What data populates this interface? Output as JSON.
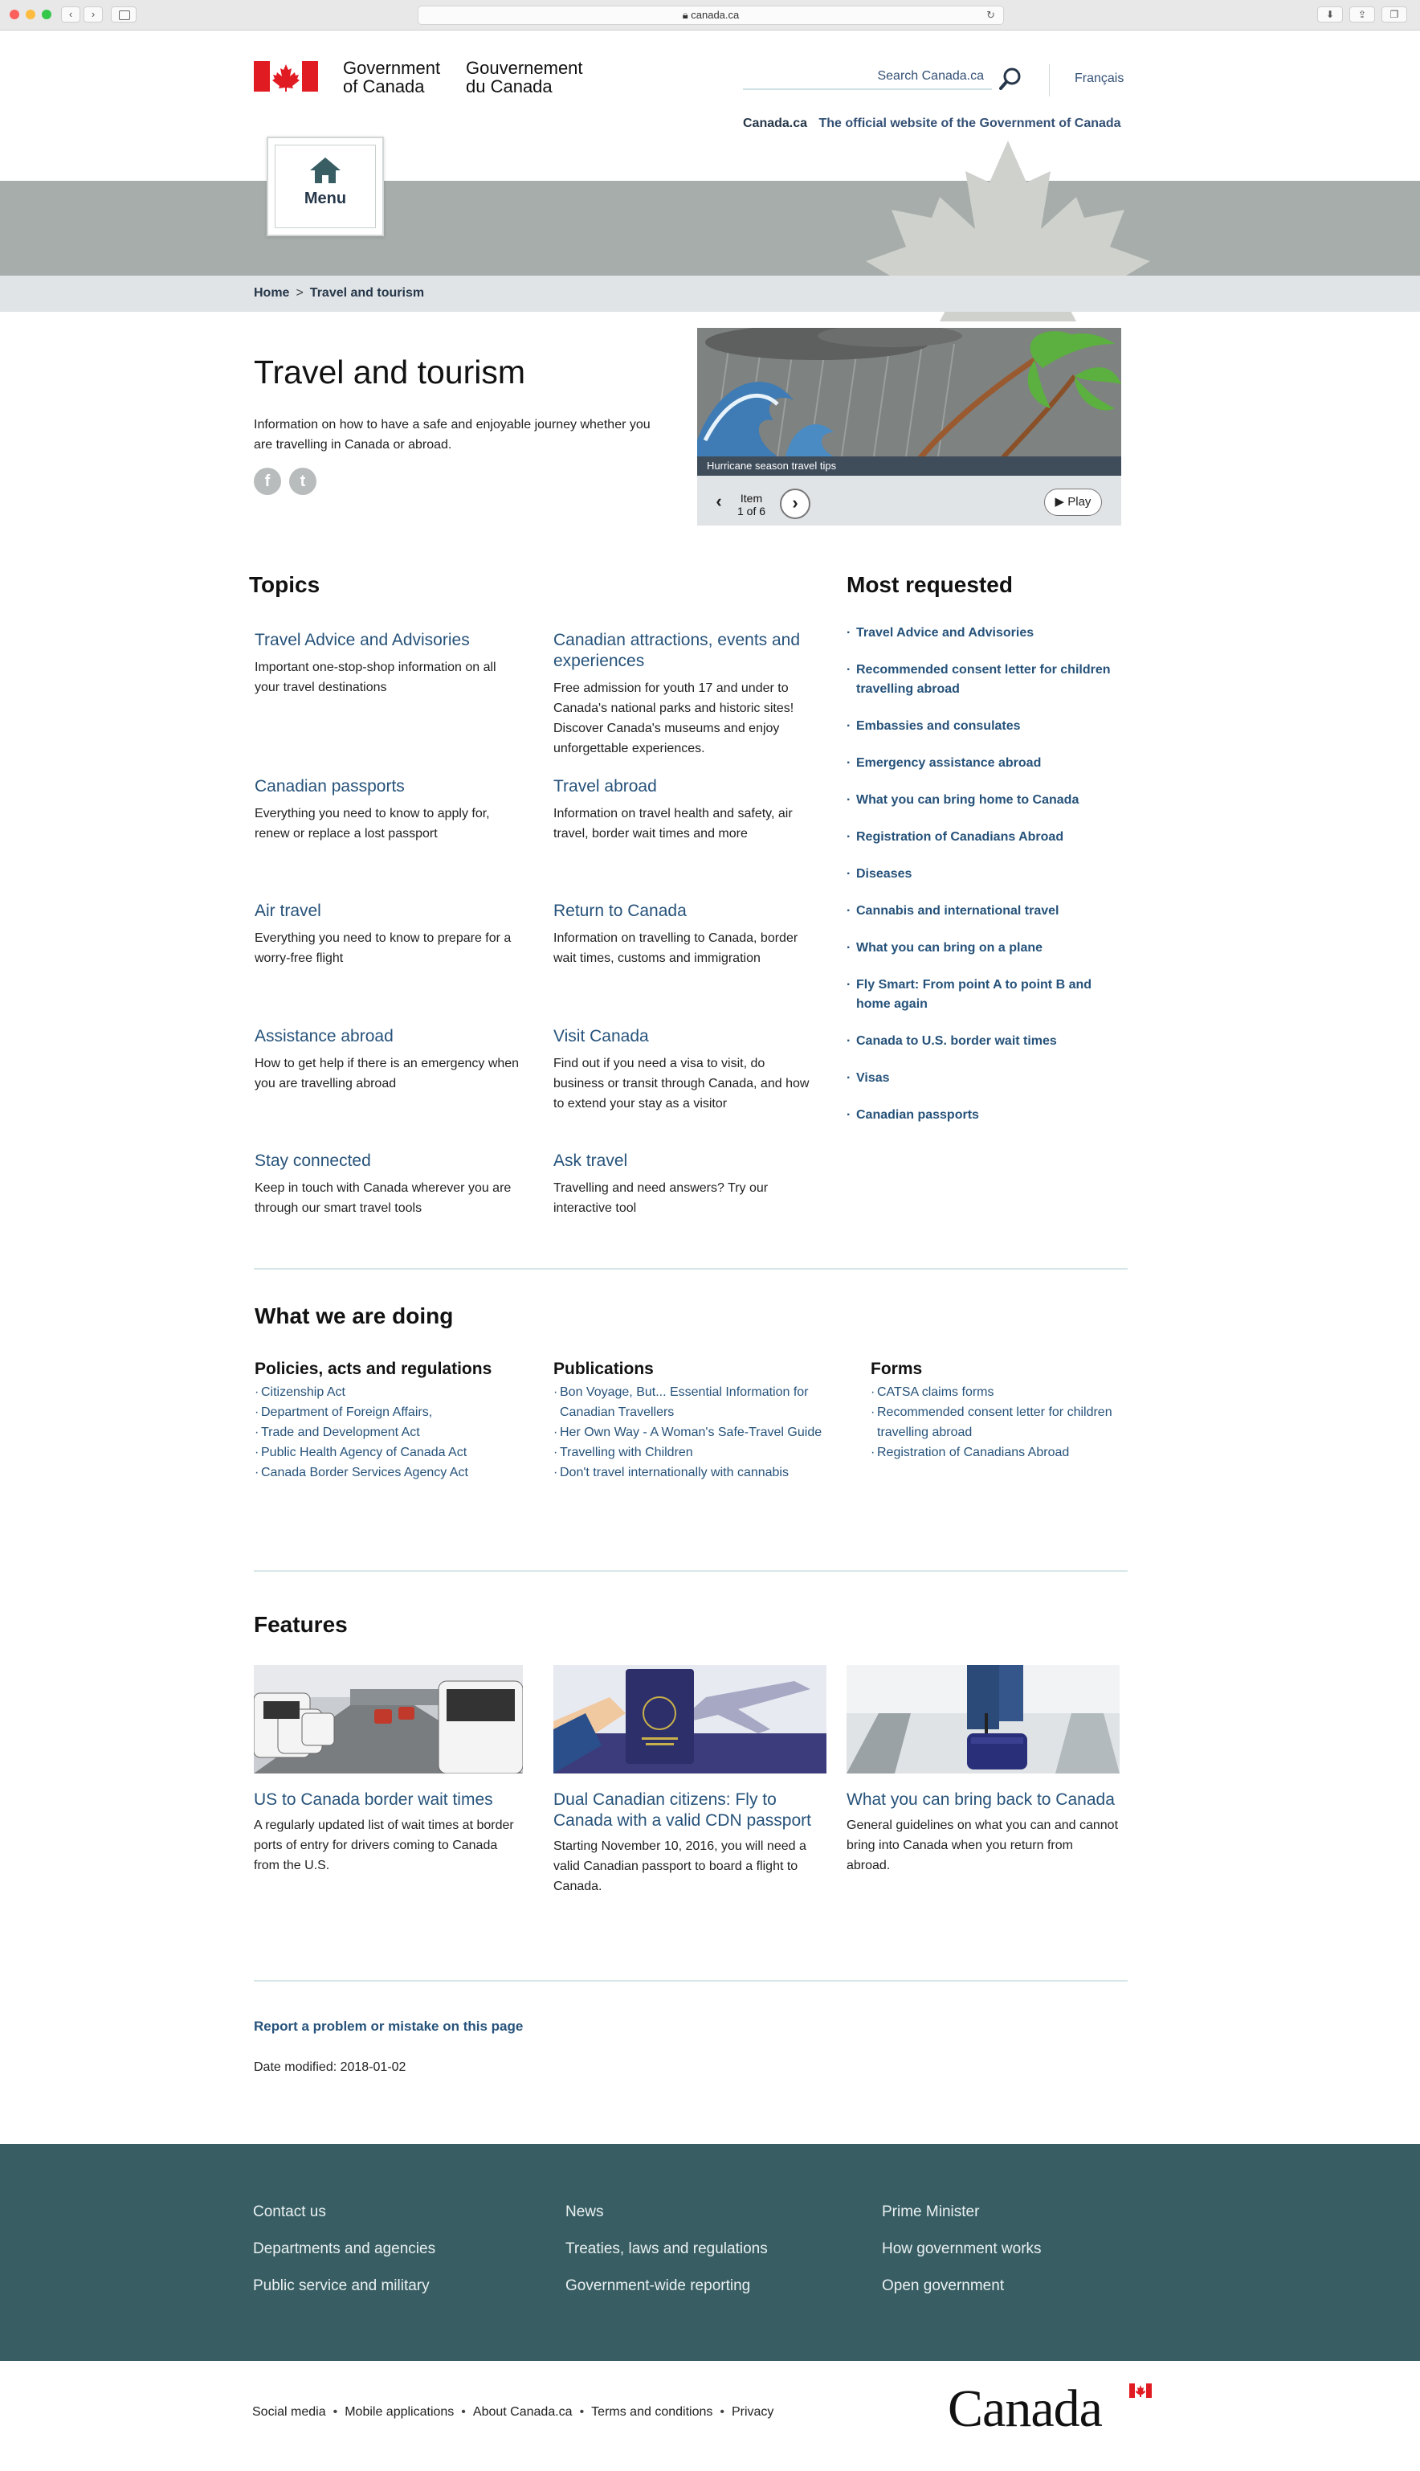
{
  "browser": {
    "url": "canada.ca",
    "colors": {
      "close": "#fc605c",
      "min": "#fdbc40",
      "max": "#34c84a"
    }
  },
  "header": {
    "gov_en_line1": "Government",
    "gov_en_line2": "of Canada",
    "gov_fr_line1": "Gouvernement",
    "gov_fr_line2": "du Canada",
    "search_placeholder": "Search Canada.ca",
    "language": "Français",
    "tagline_brand": "Canada.ca",
    "tagline_rest": "The official website of the Government of Canada",
    "menu_label": "Menu"
  },
  "breadcrumb": {
    "home": "Home",
    "separator": ">",
    "current": "Travel and tourism"
  },
  "page": {
    "title": "Travel and tourism",
    "lead": "Information on how to have a safe and enjoyable journey whether you are travelling in Canada or abroad."
  },
  "carousel": {
    "caption": "Hurricane season travel tips",
    "item_label": "Item",
    "item_count": "1 of 6",
    "play_label": "Play"
  },
  "topics": {
    "heading": "Topics",
    "items": [
      {
        "title": "Travel Advice and Advisories",
        "desc": "Important one-stop-shop information on all your travel destinations"
      },
      {
        "title": "Canadian attractions, events and experiences",
        "desc": "Free admission for youth 17 and under to Canada's national parks and historic sites! Discover Canada's museums and enjoy unforgettable experiences."
      },
      {
        "title": "Canadian passports",
        "desc": "Everything you need to know to apply for, renew or replace a lost passport"
      },
      {
        "title": "Travel abroad",
        "desc": "Information on travel health and safety, air travel, border wait times and more"
      },
      {
        "title": "Air travel",
        "desc": "Everything you need to know to prepare for a worry-free flight"
      },
      {
        "title": "Return to Canada",
        "desc": "Information on travelling to Canada, border wait times, customs and immigration"
      },
      {
        "title": "Assistance abroad",
        "desc": "How to get help if there is an emergency when you are travelling abroad"
      },
      {
        "title": "Visit Canada",
        "desc": "Find out if you need a visa to visit, do business or transit through Canada, and how to extend your stay as a visitor"
      },
      {
        "title": "Stay connected",
        "desc": "Keep in touch with Canada wherever you are through our smart travel tools"
      },
      {
        "title": "Ask travel",
        "desc": "Travelling and need answers? Try our interactive tool"
      }
    ]
  },
  "most_requested": {
    "heading": "Most requested",
    "items": [
      "Travel Advice and Advisories",
      "Recommended consent letter for children travelling abroad",
      "Embassies and consulates",
      "Emergency assistance abroad",
      "What you can bring home to Canada",
      "Registration of Canadians Abroad",
      "Diseases",
      "Cannabis and international travel",
      "What you can bring on a plane",
      "Fly Smart: From point A to point B and home again",
      "Canada to U.S. border wait times",
      "Visas",
      "Canadian passports"
    ]
  },
  "doing": {
    "heading": "What we are doing",
    "policies": {
      "title": "Policies, acts and regulations",
      "items": [
        "Citizenship Act",
        "Department of Foreign Affairs,",
        "Trade and Development Act",
        "Public Health Agency of Canada Act",
        "Canada Border Services Agency Act"
      ]
    },
    "publications": {
      "title": "Publications",
      "items": [
        "Bon Voyage, But... Essential Information for Canadian Travellers",
        "Her Own Way - A Woman's Safe-Travel Guide",
        "Travelling with Children",
        "Don't travel internationally with cannabis"
      ]
    },
    "forms": {
      "title": "Forms",
      "items": [
        "CATSA claims forms",
        "Recommended consent letter for children travelling abroad",
        "Registration of Canadians Abroad"
      ]
    }
  },
  "features": {
    "heading": "Features",
    "items": [
      {
        "title": "US to Canada border wait times",
        "desc": "A regularly updated list of wait times at border ports of entry for drivers coming to Canada from the U.S."
      },
      {
        "title": "Dual Canadian citizens: Fly to Canada with a valid CDN passport",
        "desc": "Starting November 10, 2016, you will need a valid Canadian passport to board a flight to Canada."
      },
      {
        "title": "What you can bring back to Canada",
        "desc": "General guidelines on what you can and cannot bring into Canada when you return from abroad."
      }
    ]
  },
  "page_footer": {
    "report": "Report a problem or mistake on this page",
    "modified": "Date modified: 2018-01-02"
  },
  "footer": {
    "col1": [
      "Contact us",
      "Departments and agencies",
      "Public service and military"
    ],
    "col2": [
      "News",
      "Treaties, laws and regulations",
      "Government-wide reporting"
    ],
    "col3": [
      "Prime Minister",
      "How government works",
      "Open government"
    ],
    "bottom": [
      "Social media",
      "Mobile applications",
      "About Canada.ca",
      "Terms and conditions",
      "Privacy"
    ],
    "wordmark": "Canada"
  }
}
